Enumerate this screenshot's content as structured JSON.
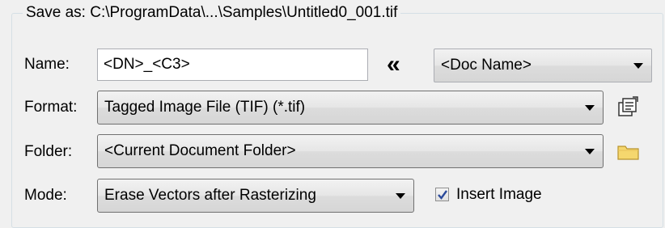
{
  "save_as": {
    "label": "Save as:",
    "path": "C:\\ProgramData\\...\\Samples\\Untitled0_001.tif"
  },
  "name_row": {
    "label": "Name:",
    "value": "<DN>_<C3>",
    "insert_button": "«",
    "token_select": "<Doc Name>"
  },
  "format_row": {
    "label": "Format:",
    "value": "Tagged Image File (TIF) (*.tif)",
    "options_icon": "properties-icon"
  },
  "folder_row": {
    "label": "Folder:",
    "value": "<Current Document Folder>",
    "browse_icon": "folder-icon"
  },
  "mode_row": {
    "label": "Mode:",
    "value": "Erase Vectors after Rasterizing",
    "checkbox_label": "Insert Image",
    "checkbox_checked": true
  },
  "colors": {
    "background": "#f0f0f0",
    "folder": "#f5d76e",
    "check": "#2b4a9b"
  }
}
